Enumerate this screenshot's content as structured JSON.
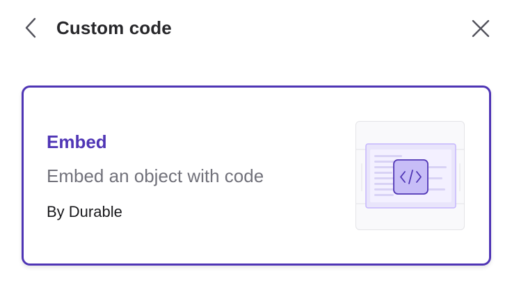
{
  "header": {
    "title": "Custom code",
    "back_icon": "chevron-left-icon",
    "close_icon": "close-icon"
  },
  "card": {
    "name": "Embed",
    "description": "Embed an object with code",
    "author": "By Durable",
    "thumbnail_icon": "code-icon"
  },
  "colors": {
    "accent": "#4f35b5",
    "title_text": "#27272a",
    "muted_text": "#71717a",
    "thumb_fill": "#ede9fe"
  }
}
